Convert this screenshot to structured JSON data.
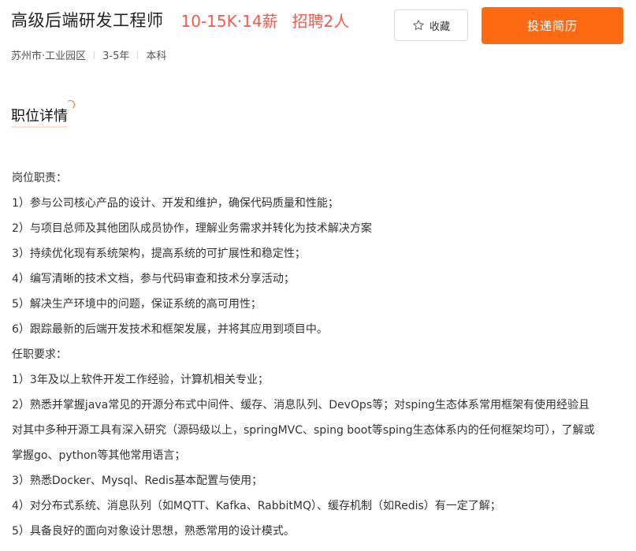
{
  "job": {
    "title": "高级后端研发工程师",
    "salary": "10-15K·14薪",
    "headcount": "招聘2人"
  },
  "actions": {
    "collect_label": "收藏",
    "apply_label": "投递简历"
  },
  "meta": {
    "location": "苏州市·工业园区",
    "experience": "3-5年",
    "education": "本科"
  },
  "section": {
    "title": "职位详情"
  },
  "description": {
    "lines": [
      "岗位职责：",
      "1）参与公司核心产品的设计、开发和维护，确保代码质量和性能；",
      "2）与项目总师及其他团队成员协作，理解业务需求并转化为技术解决方案",
      "3）持续优化现有系统架构，提高系统的可扩展性和稳定性；",
      "4）编写清晰的技术文档，参与代码审查和技术分享活动；",
      "5）解决生产环境中的问题，保证系统的高可用性；",
      "6）跟踪最新的后端开发技术和框架发展，并将其应用到项目中。",
      "任职要求：",
      "1）3年及以上软件开发工作经验，计算机相关专业；",
      "2）熟悉并掌握java常见的开源分布式中间件、缓存、消息队列、DevOps等；对sping生态体系常用框架有使用经验且",
      "对其中多种开源工具有深入研究（源码级以上，springMVC、sping boot等sping生态体系内的任何框架均可），了解或",
      "掌握go、python等其他常用语言；",
      "3）熟悉Docker、Mysql、Redis基本配置与使用；",
      "4）对分布式系统、消息队列（如MQTT、Kafka、RabbitMQ）、缓存机制（如Redis）有一定了解；",
      "5）具备良好的面向对象设计思想，熟悉常用的设计模式。"
    ]
  },
  "colors": {
    "accent": "#fe6a12",
    "salary": "#fe574a"
  },
  "icons": {
    "collect": "star-outline-icon"
  }
}
